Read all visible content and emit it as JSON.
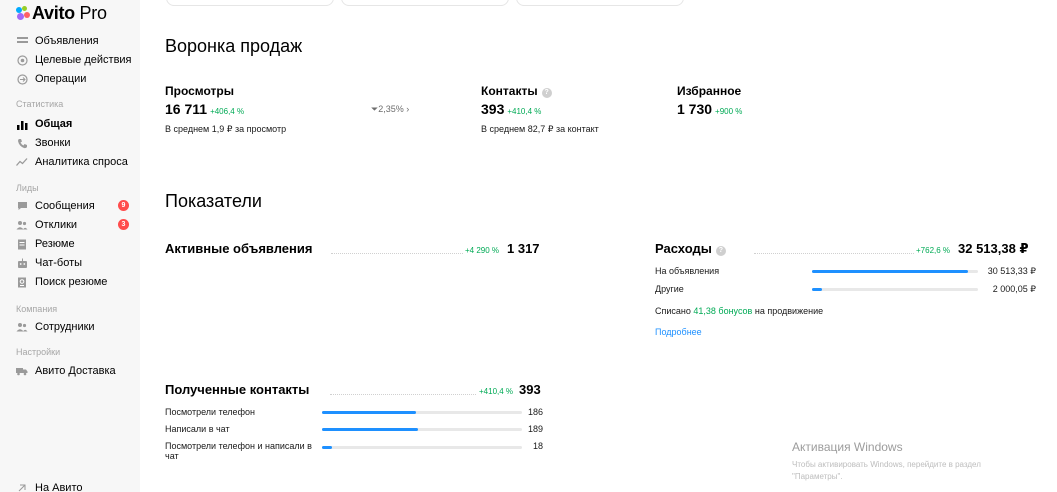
{
  "logo": {
    "brand": "Avito",
    "suffix": " Pro"
  },
  "sidebar": {
    "items_top": [
      {
        "label": "Объявления",
        "icon": "listing-icon"
      },
      {
        "label": "Целевые действия",
        "icon": "target-icon"
      },
      {
        "label": "Операции",
        "icon": "operations-icon"
      }
    ],
    "group_stats": "Статистика",
    "items_stats": [
      {
        "label": "Общая",
        "icon": "bar-chart-icon",
        "active": true
      },
      {
        "label": "Звонки",
        "icon": "phone-icon"
      },
      {
        "label": "Аналитика спроса",
        "icon": "trend-icon"
      }
    ],
    "group_leads": "Лиды",
    "items_leads": [
      {
        "label": "Сообщения",
        "icon": "chat-icon",
        "badge": "9"
      },
      {
        "label": "Отклики",
        "icon": "people-icon",
        "badge": "3"
      },
      {
        "label": "Резюме",
        "icon": "document-icon"
      },
      {
        "label": "Чат-боты",
        "icon": "bot-icon"
      },
      {
        "label": "Поиск резюме",
        "icon": "search-doc-icon"
      }
    ],
    "group_company": "Компания",
    "items_company": [
      {
        "label": "Сотрудники",
        "icon": "people-icon"
      }
    ],
    "group_settings": "Настройки",
    "items_settings": [
      {
        "label": "Авито Доставка",
        "icon": "truck-icon"
      }
    ],
    "back_link": "На Авито"
  },
  "funnel": {
    "title": "Воронка продаж",
    "views": {
      "label": "Просмотры",
      "value": "16 711",
      "delta": "+406,4 %",
      "note": "В среднем 1,9 ₽ за просмотр"
    },
    "conversion": "2,35%",
    "contacts": {
      "label": "Контакты",
      "value": "393",
      "delta": "+410,4 %",
      "note": "В среднем 82,7 ₽ за контакт"
    },
    "favorites": {
      "label": "Избранное",
      "value": "1 730",
      "delta": "+900 %"
    }
  },
  "indicators": {
    "title": "Показатели",
    "active_ads": {
      "label": "Активные объявления",
      "delta": "+4 290 %",
      "value": "1 317"
    },
    "expenses": {
      "label": "Расходы",
      "delta": "+762,6 %",
      "value": "32 513,38 ₽",
      "rows": [
        {
          "label": "На объявления",
          "value": "30 513,33 ₽",
          "share": 0.94
        },
        {
          "label": "Другие",
          "value": "2 000,05 ₽",
          "share": 0.06
        }
      ],
      "bonus_prefix": "Списано ",
      "bonus_link": "41,38 бонусов",
      "bonus_suffix": " на продвижение",
      "more_link": "Подробнее"
    },
    "contacts_received": {
      "label": "Полученные контакты",
      "delta": "+410,4 %",
      "value": "393",
      "rows": [
        {
          "label": "Посмотрели телефон",
          "value": "186",
          "share": 0.47
        },
        {
          "label": "Написали в чат",
          "value": "189",
          "share": 0.48
        },
        {
          "label": "Посмотрели телефон и написали в чат",
          "value": "18",
          "share": 0.05
        }
      ]
    }
  },
  "watermark": {
    "title": "Активация Windows",
    "subtitle": "Чтобы активировать Windows, перейдите в раздел \"Параметры\"."
  },
  "colors": {
    "accent": "#1e90ff",
    "positive": "#00aa55",
    "badge": "#ff4c4c"
  }
}
